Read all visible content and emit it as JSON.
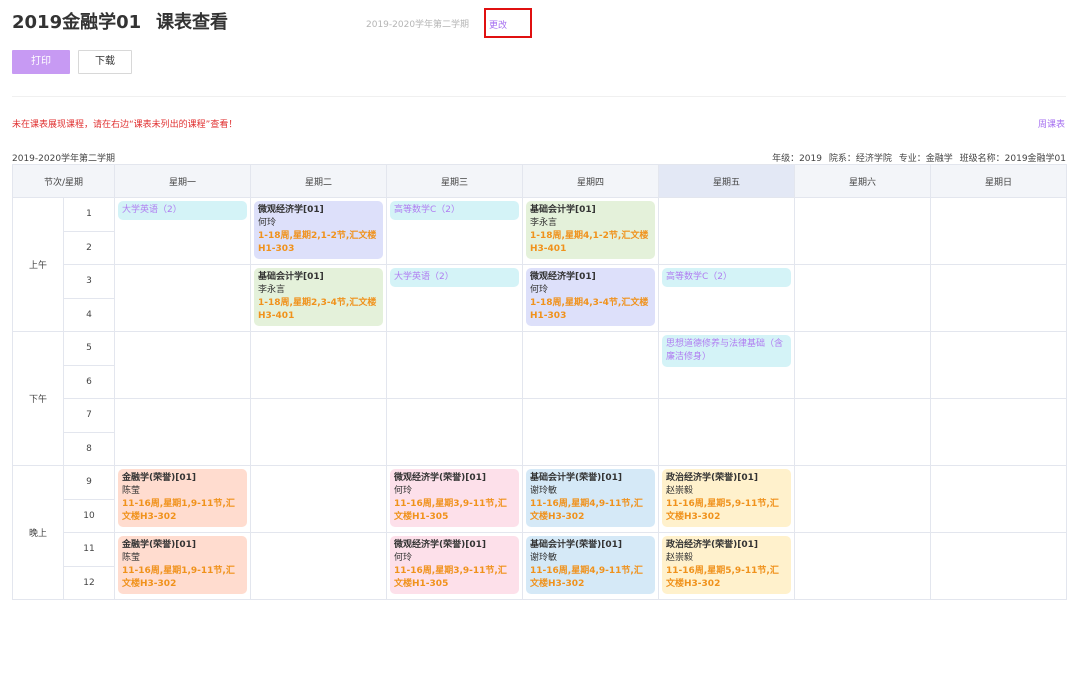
{
  "header": {
    "class_name": "2019金融学01",
    "page_title": "课表查看",
    "semester": "2019-2020学年第二学期",
    "change_link": "更改"
  },
  "toolbar": {
    "print_label": "打印",
    "download_label": "下载"
  },
  "notice": "未在课表展现课程，请在右边“课表未列出的课程”查看！",
  "weekly_link": "周课表",
  "info": {
    "semester": "2019-2020学年第二学期",
    "grade": "年级：2019",
    "college": "院系：经济学院",
    "major": "专业：金融学",
    "class": "班级名称：2019金融学01"
  },
  "table": {
    "corner": "节次/星期",
    "days": [
      "星期一",
      "星期二",
      "星期三",
      "星期四",
      "星期五",
      "星期六",
      "星期日"
    ],
    "today_index": 4,
    "groups": [
      "上午",
      "下午",
      "晚上"
    ],
    "periods": [
      "1",
      "2",
      "3",
      "4",
      "5",
      "6",
      "7",
      "8",
      "9",
      "10",
      "11",
      "12"
    ]
  },
  "courses": {
    "mon_1": {
      "name": "大学英语（2）"
    },
    "tue_1": {
      "name": "微观经济学[01]",
      "teacher": "何玲",
      "detail": "1-18周,星期2,1-2节,汇文楼H1-303"
    },
    "wed_1": {
      "name": "高等数学C（2）"
    },
    "thu_1": {
      "name": "基础会计学[01]",
      "teacher": "李永言",
      "detail": "1-18周,星期4,1-2节,汇文楼H3-401"
    },
    "tue_3": {
      "name": "基础会计学[01]",
      "teacher": "李永言",
      "detail": "1-18周,星期2,3-4节,汇文楼H3-401"
    },
    "wed_3": {
      "name": "大学英语（2）"
    },
    "thu_3": {
      "name": "微观经济学[01]",
      "teacher": "何玲",
      "detail": "1-18周,星期4,3-4节,汇文楼H1-303"
    },
    "fri_3": {
      "name": "高等数学C（2）"
    },
    "fri_5": {
      "name": "思想道德修养与法律基础（含廉洁修身）"
    },
    "mon_9": {
      "name": "金融学(荣誉)[01]",
      "teacher": "陈莹",
      "detail": "11-16周,星期1,9-11节,汇文楼H3-302"
    },
    "wed_9": {
      "name": "微观经济学(荣誉)[01]",
      "teacher": "何玲",
      "detail": "11-16周,星期3,9-11节,汇文楼H1-305"
    },
    "thu_9": {
      "name": "基础会计学(荣誉)[01]",
      "teacher": "谢玲敏",
      "detail": "11-16周,星期4,9-11节,汇文楼H3-302"
    },
    "fri_9": {
      "name": "政治经济学(荣誉)[01]",
      "teacher": "赵崇毅",
      "detail": "11-16周,星期5,9-11节,汇文楼H3-302"
    },
    "mon_11": {
      "name": "金融学(荣誉)[01]",
      "teacher": "陈莹",
      "detail": "11-16周,星期1,9-11节,汇文楼H3-302"
    },
    "wed_11": {
      "name": "微观经济学(荣誉)[01]",
      "teacher": "何玲",
      "detail": "11-16周,星期3,9-11节,汇文楼H1-305"
    },
    "thu_11": {
      "name": "基础会计学(荣誉)[01]",
      "teacher": "谢玲敏",
      "detail": "11-16周,星期4,9-11节,汇文楼H3-302"
    },
    "fri_11": {
      "name": "政治经济学(荣誉)[01]",
      "teacher": "赵崇毅",
      "detail": "11-16周,星期5,9-11节,汇文楼H3-302"
    }
  },
  "colors": {
    "accent": "#a56ff0",
    "print_button": "#c79af3",
    "notice_red": "#e03030",
    "detail_orange": "#f0921c",
    "highlight_box": "#e01010"
  }
}
